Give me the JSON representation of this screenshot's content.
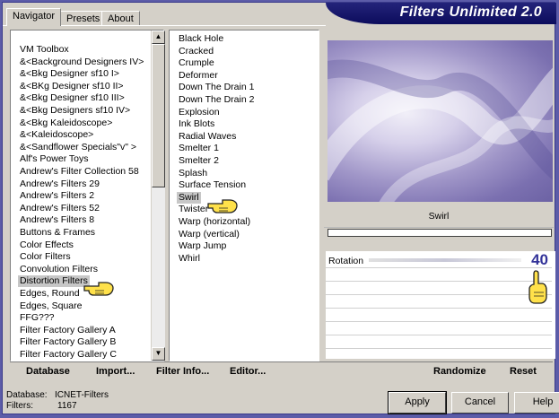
{
  "header": {
    "title": "Filters Unlimited 2.0"
  },
  "tabs": [
    "Navigator",
    "Presets",
    "About"
  ],
  "filter_categories": [
    "VM Toolbox",
    "&<Background Designers IV>",
    "&<Bkg Designer sf10 I>",
    "&<BKg Designer sf10 II>",
    "&<Bkg Designer sf10 III>",
    "&<Bkg Designers sf10 IV>",
    "&<Bkg Kaleidoscope>",
    "&<Kaleidoscope>",
    "&<Sandflower Specials\"v\" >",
    "Alf's Power Toys",
    "Andrew's Filter Collection 58",
    "Andrew's Filters 29",
    "Andrew's Filters 2",
    "Andrew's Filters 52",
    "Andrew's Filters 8",
    "Buttons & Frames",
    "Color Effects",
    "Color Filters",
    "Convolution Filters",
    "Distortion Filters",
    "Edges, Round",
    "Edges, Square",
    "FFG???",
    "Filter Factory Gallery A",
    "Filter Factory Gallery B",
    "Filter Factory Gallery C"
  ],
  "selected_category": "Distortion Filters",
  "effects": [
    "Black Hole",
    "Cracked",
    "Crumple",
    "Deformer",
    "Down The Drain 1",
    "Down The Drain 2",
    "Explosion",
    "Ink Blots",
    "Radial Waves",
    "Smelter 1",
    "Smelter 2",
    "Splash",
    "Surface Tension",
    "Swirl",
    "Twister",
    "Warp (horizontal)",
    "Warp (vertical)",
    "Warp Jump",
    "Whirl"
  ],
  "selected_effect": "Swirl",
  "preview": {
    "filter_name": "Swirl"
  },
  "parameters": [
    {
      "label": "Rotation",
      "value": "40"
    }
  ],
  "bottom_links": {
    "database": "Database",
    "import": "Import...",
    "filter_info": "Filter Info...",
    "editor": "Editor...",
    "randomize": "Randomize",
    "reset": "Reset"
  },
  "status": {
    "database_label": "Database:",
    "database_value": "ICNET-Filters",
    "filters_label": "Filters:",
    "filters_value": "1167"
  },
  "buttons": {
    "apply": "Apply",
    "cancel": "Cancel",
    "help": "Help"
  },
  "scrollbar": {
    "up": "▲",
    "down": "▼"
  }
}
